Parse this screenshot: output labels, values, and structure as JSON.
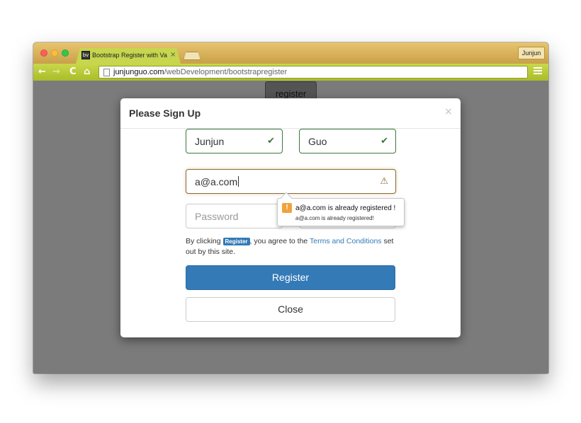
{
  "browser": {
    "tab_title": "Bootstrap Register with Va",
    "tab_close": "×",
    "favicon_text": "bv",
    "profile_label": "Junjun",
    "url_host": "junjunguo.com",
    "url_path": "/webDevelopment/bootstrapregister",
    "icons": {
      "back": "←",
      "forward": "→",
      "reload": "C",
      "home": "⌂",
      "star": "☆"
    }
  },
  "page": {
    "register_button_label": "register"
  },
  "modal": {
    "title": "Please Sign Up",
    "close_glyph": "×",
    "first_name": "Junjun",
    "last_name": "Guo",
    "email": "a@a.com",
    "password_placeholder": "Password",
    "success_glyph": "✔",
    "warning_glyph": "⚠",
    "tooltip": {
      "icon_glyph": "!",
      "message": "a@a.com is already registered !",
      "detail": "a@a.com is already registered!"
    },
    "terms": {
      "prefix": "By clicking ",
      "badge": "Register",
      "middle": ", you agree to the ",
      "link": "Terms and Conditions",
      "suffix": " set out by this site."
    },
    "register_label": "Register",
    "close_label": "Close"
  },
  "colors": {
    "primary": "#337ab7",
    "success": "#3c763d",
    "warning": "#8a6d3b",
    "tooltip_icon": "#f0a33c"
  }
}
